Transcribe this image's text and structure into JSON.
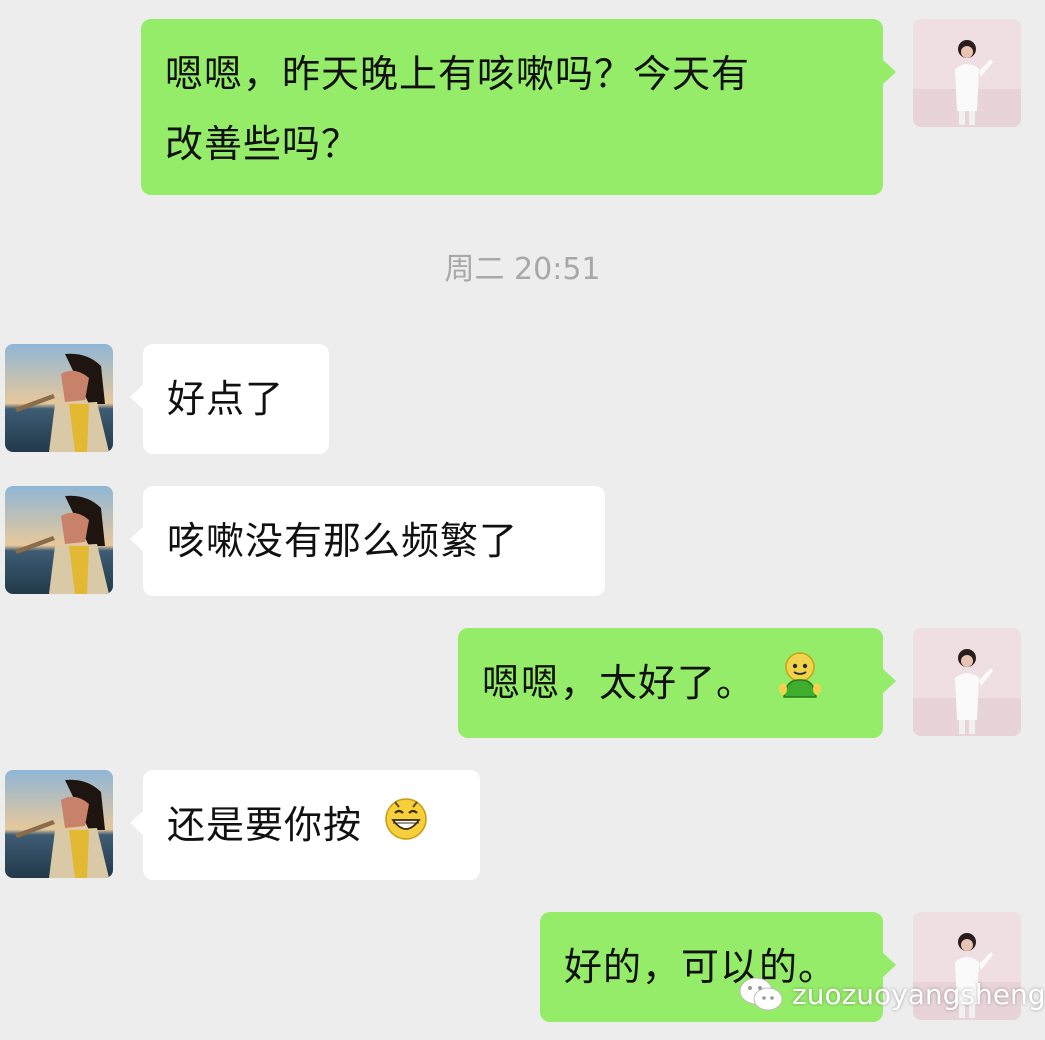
{
  "chat": {
    "timestamp": "周二 20:51",
    "messages": [
      {
        "sender": "me",
        "line1": "嗯嗯，昨天晚上有咳嗽吗？今天有",
        "line2": "改善些吗？"
      },
      {
        "sender": "them",
        "text": "好点了"
      },
      {
        "sender": "them",
        "text": "咳嗽没有那么频繁了"
      },
      {
        "sender": "me",
        "text": "嗯嗯，太好了。",
        "emoji": "green-person-emoji"
      },
      {
        "sender": "them",
        "text": "还是要你按",
        "emoji": "grin-emoji"
      },
      {
        "sender": "me",
        "text": "好的，可以的。"
      }
    ]
  },
  "watermark": {
    "text": "zuozuoyangsheng",
    "icon": "wechat-logo"
  },
  "colors": {
    "background": "#ededed",
    "my_bubble": "#95ec69",
    "their_bubble": "#ffffff",
    "timestamp": "#a8a8a8"
  }
}
